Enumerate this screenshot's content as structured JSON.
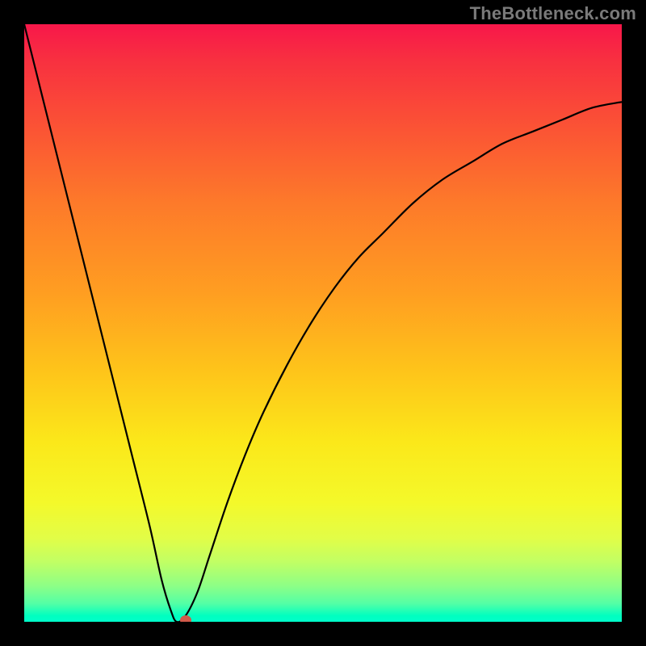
{
  "watermark": "TheBottleneck.com",
  "chart_data": {
    "type": "line",
    "title": "",
    "xlabel": "",
    "ylabel": "",
    "xlim": [
      0,
      100
    ],
    "ylim": [
      0,
      100
    ],
    "grid": false,
    "legend": false,
    "x": [
      0,
      3,
      6,
      9,
      12,
      15,
      18,
      21,
      23,
      24.5,
      25.5,
      27,
      29,
      31,
      34,
      37,
      40,
      44,
      48,
      52,
      56,
      60,
      65,
      70,
      75,
      80,
      85,
      90,
      95,
      100
    ],
    "y": [
      100,
      88,
      76,
      64,
      52,
      40,
      28,
      16,
      7,
      2,
      0,
      1,
      5,
      11,
      20,
      28,
      35,
      43,
      50,
      56,
      61,
      65,
      70,
      74,
      77,
      80,
      82,
      84,
      86,
      87
    ],
    "marker": {
      "x": 27,
      "y": 0
    },
    "background": "red-yellow-green vertical gradient"
  }
}
